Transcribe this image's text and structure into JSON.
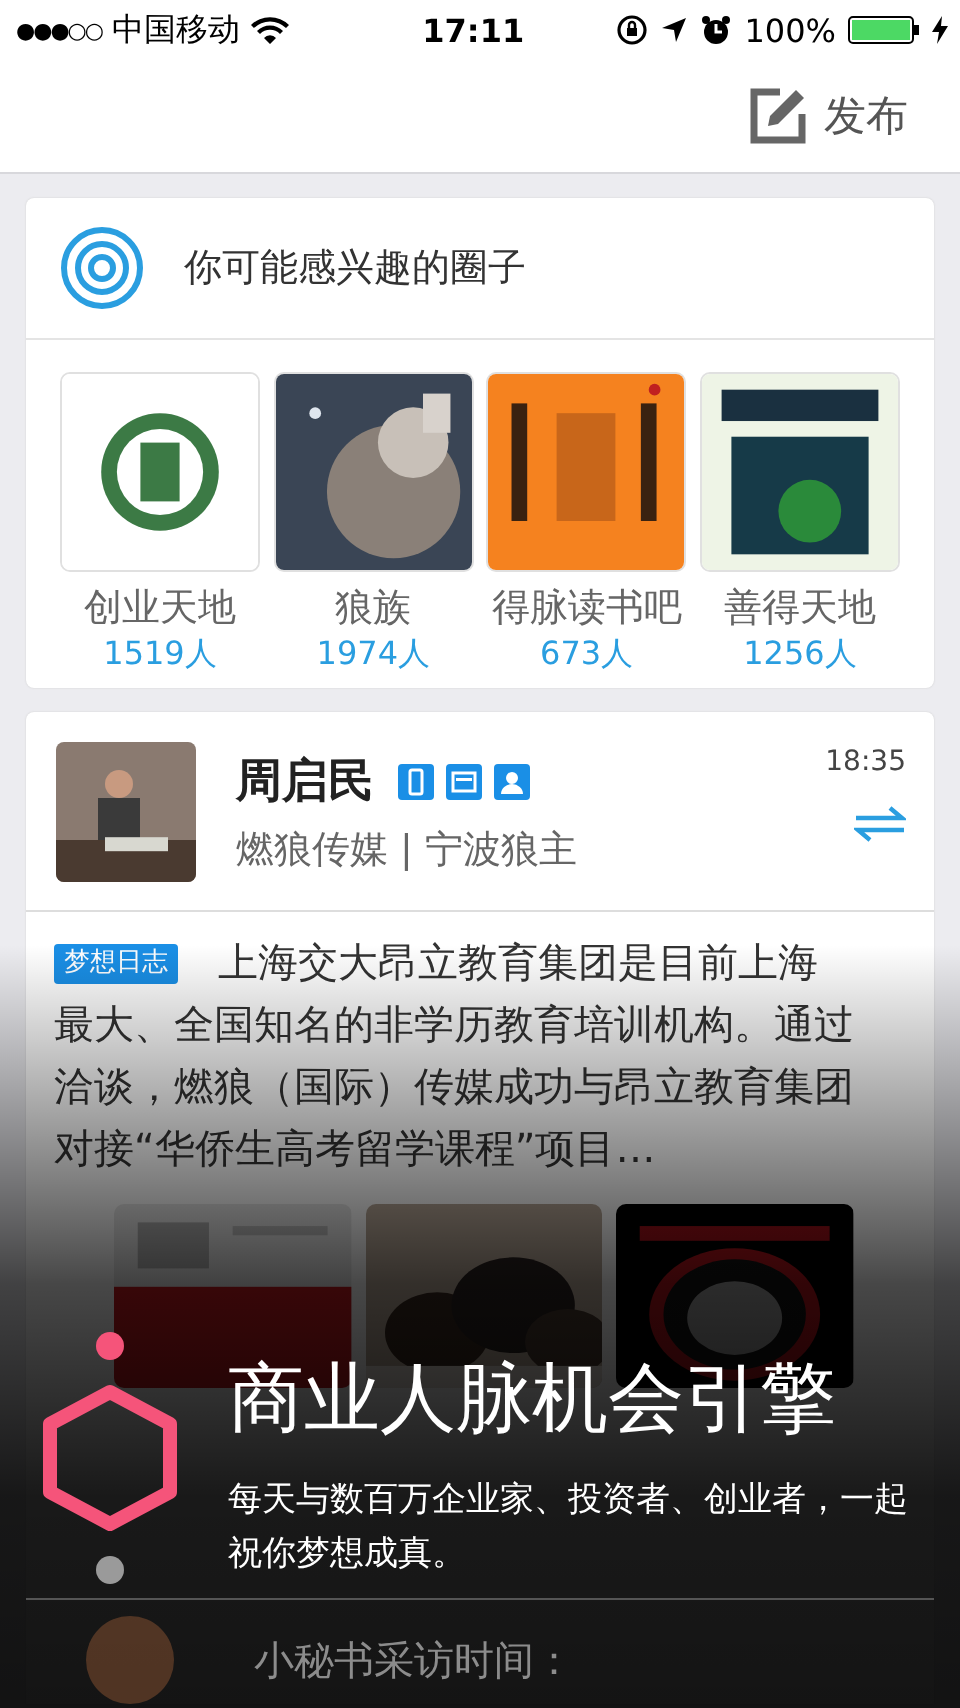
{
  "status_bar": {
    "signal": "●●●○○",
    "carrier": "中国移动",
    "time": "17:11",
    "battery": "100%"
  },
  "nav": {
    "publish": "发布"
  },
  "circles": {
    "title": "你可能感兴趣的圈子",
    "items": [
      {
        "name": "创业天地",
        "members": "1519人"
      },
      {
        "name": "狼族",
        "members": "1974人"
      },
      {
        "name": "得脉读书吧",
        "members": "673人"
      },
      {
        "name": "善得天地",
        "members": "1256人"
      }
    ]
  },
  "post": {
    "author": "周启民",
    "subtitle": "燃狼传媒 | 宁波狼主",
    "time": "18:35",
    "tag": "梦想日志",
    "text": "上海交大昂立教育集团是目前上海最大、全国知名的非学历教育培训机构。通过洽谈，燃狼（国际）传媒成功与昂立教育集团对接“华侨生高考留学课程”项目…"
  },
  "next_post": {
    "title": "小秘书采访时间："
  },
  "onboarding": {
    "title": "商业人脉机会引擎",
    "subtitle": "每天与数百万企业家、投资者、创业者，一起祝你梦想成真。",
    "steps": [
      {
        "kind": "dot",
        "done": true
      },
      {
        "kind": "hexagon",
        "done": true
      },
      {
        "kind": "dot",
        "done": false
      }
    ]
  }
}
